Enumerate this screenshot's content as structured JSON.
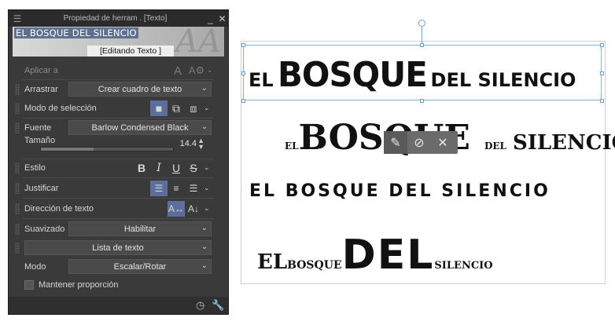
{
  "panel": {
    "title": "Propiedad de herram . [Texto]",
    "preview_text": "EL BOSQUE DEL SILENCIO",
    "preview_deco": "AA",
    "preview_state": "[Editando Texto ]",
    "apply_to_label": "Aplicar a",
    "drag_label": "Arrastrar",
    "drag_value": "Crear cuadro de texto",
    "selection_mode_label": "Modo de selección",
    "font_label": "Fuente",
    "font_value": "Barlow Condensed Black",
    "size_label": "Tamaño",
    "size_value": "14.4",
    "size_fraction": 0.4,
    "style_label": "Estilo",
    "style_bold": "B",
    "style_italic": "I",
    "style_underline": "U",
    "style_strike": "S",
    "justify_label": "Justificar",
    "direction_label": "Dirección de texto",
    "smoothing_label": "Suavizado",
    "smoothing_value": "Habilitar",
    "text_list_value": "Lista de texto",
    "mode_label": "Modo",
    "mode_value": "Escalar/Rotar",
    "keep_ratio_label": "Mantener proporción"
  },
  "canvas": {
    "line1": {
      "a": "EL ",
      "b": "BOSQUE",
      "c": " DEL SILENCIO"
    },
    "line2": {
      "a": "EL ",
      "b": "BOSQUE",
      "c": "DEL ",
      "d": "SILENCIO"
    },
    "line3": "EL BOSQUE DEL SILENCIO",
    "line4": {
      "a": "EL ",
      "b": "BOSQUE ",
      "c": "DEL",
      "d": " SILENCIO"
    }
  },
  "icons": {
    "menu": "☰",
    "minimize": "_",
    "close": "✕",
    "dropdown": "⌄",
    "pen": "✎",
    "confirm": "⊘",
    "cancel": "✕"
  }
}
